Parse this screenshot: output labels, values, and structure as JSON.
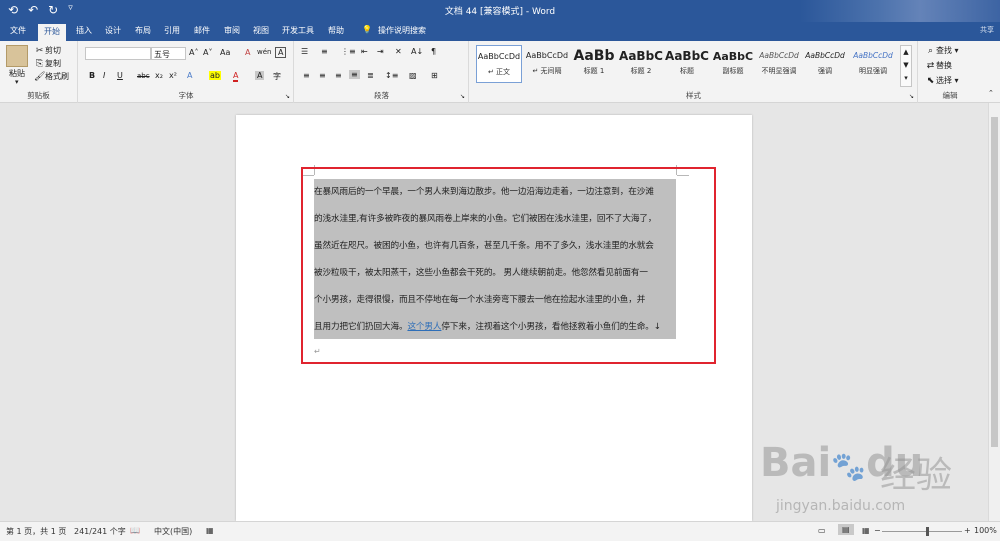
{
  "titlebar": {
    "title": "文档 44 [兼容模式] - Word"
  },
  "tabs": [
    "文件",
    "开始",
    "插入",
    "设计",
    "布局",
    "引用",
    "邮件",
    "审阅",
    "视图",
    "开发工具",
    "帮助"
  ],
  "active_tab_index": 1,
  "tell_me": "操作说明搜索",
  "share": "共享",
  "clipboard": {
    "paste": "粘贴",
    "cut": "剪切",
    "copy": "复制",
    "format_painter": "格式刷",
    "label": "剪贴板"
  },
  "font": {
    "font_name": "",
    "font_size": "五号",
    "label": "字体",
    "grow": "A˄",
    "shrink": "A˅",
    "case": "Aa",
    "clear": "A",
    "phonetic": "wén",
    "border": "A",
    "bold": "B",
    "italic": "I",
    "underline": "U",
    "strike": "abc",
    "sub": "x₂",
    "sup": "x²",
    "text_effects": "A",
    "highlight": "ab",
    "font_color": "A",
    "shading": "A",
    "circle": "字"
  },
  "paragraph": {
    "label": "段落",
    "sort": "A↓",
    "show_marks": "¶"
  },
  "styles": {
    "label": "样式",
    "items": [
      {
        "sample": "AaBbCcDd",
        "name": "↵ 正文"
      },
      {
        "sample": "AaBbCcDd",
        "name": "↵ 无间隔"
      },
      {
        "sample": "AaBb",
        "name": "标题 1"
      },
      {
        "sample": "AaBbC",
        "name": "标题 2"
      },
      {
        "sample": "AaBbC",
        "name": "标题"
      },
      {
        "sample": "AaBbC",
        "name": "副标题"
      },
      {
        "sample": "AaBbCcDd",
        "name": "不明显强调"
      },
      {
        "sample": "AaBbCcDd",
        "name": "强调"
      },
      {
        "sample": "AaBbCcDd",
        "name": "明显强调"
      }
    ]
  },
  "editing": {
    "label": "编辑",
    "find": "查找",
    "replace": "替换",
    "select": "选择"
  },
  "document": {
    "lines": [
      "在暴风雨后的一个早晨，一个男人来到海边散步。他一边沿海边走着，一边注意到，在沙滩",
      "的浅水洼里,有许多被昨夜的暴风雨卷上岸来的小鱼。它们被困在浅水洼里，回不了大海了，",
      "虽然近在咫尺。被困的小鱼，也许有几百条，甚至几千条。用不了多久，浅水洼里的水就会",
      "被沙粒吸干，被太阳蒸干，这些小鱼都会干死的。  男人继续朝前走。他忽然看见前面有一",
      "个小男孩，走得很慢，而且不停地在每一个水洼旁弯下腰去一他在捡起水洼里的小鱼，并",
      "且用力把它们扔回大海。"
    ],
    "last_line_link": "这个男人",
    "last_line_tail": "停下来，注视着这个小男孩，看他拯救着小鱼们的生命。↓",
    "empty_para_mark": "↵"
  },
  "statusbar": {
    "page": "第 1 页，共 1 页",
    "words": "241/241 个字",
    "language": "中文(中国)",
    "zoom": "100%"
  },
  "watermark": {
    "logo": "Bai",
    "logo2": "du",
    "cn": "经验",
    "url": "jingyan.baidu.com"
  },
  "colors": {
    "word_blue": "#2b579a",
    "highlight_red": "#e0242f",
    "selection_gray": "#bfbfbf"
  }
}
